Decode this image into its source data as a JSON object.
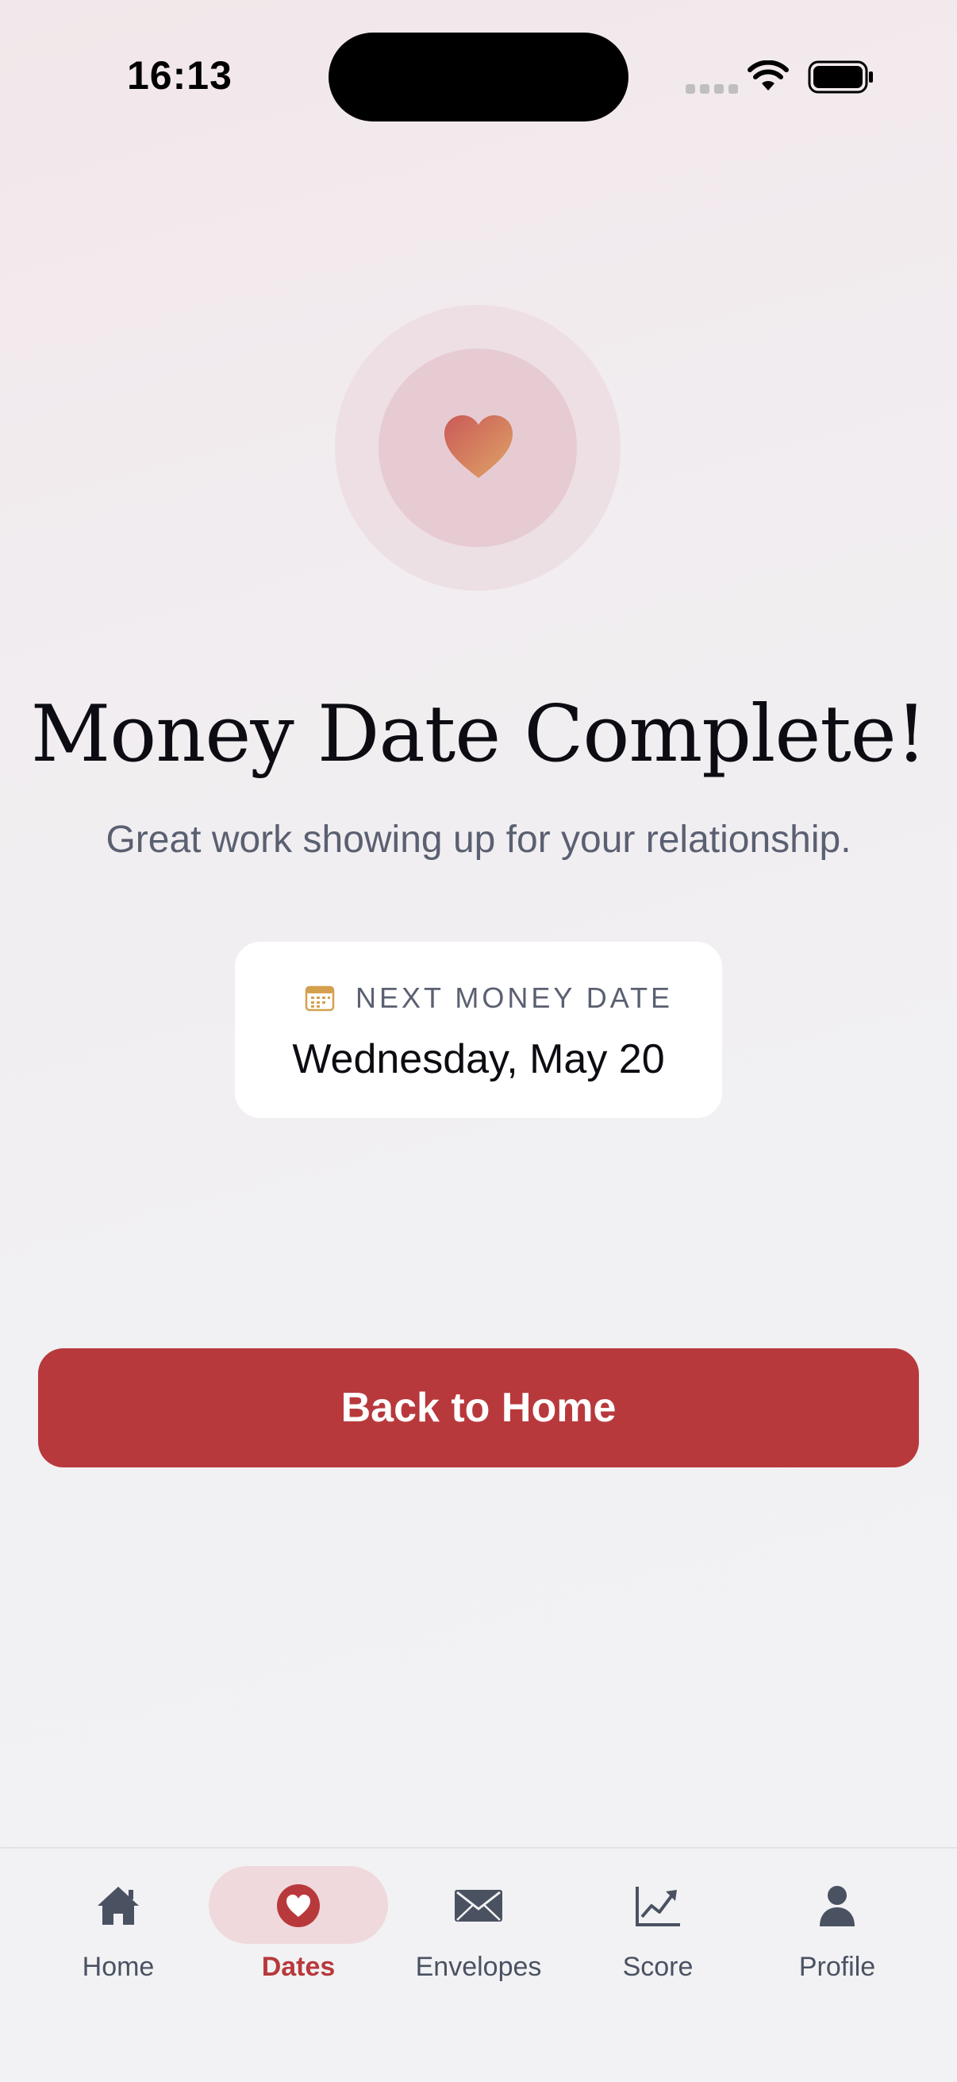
{
  "status_bar": {
    "time": "16:13"
  },
  "hero": {
    "icon": "heart-icon",
    "title": "Money Date Complete!",
    "subtitle": "Great work showing up for your relationship."
  },
  "next_date_card": {
    "icon": "calendar-icon",
    "label": "NEXT MONEY DATE",
    "date": "Wednesday, May 20"
  },
  "cta": {
    "label": "Back to Home"
  },
  "tabbar": {
    "items": [
      {
        "label": "Home",
        "icon": "home-icon",
        "active": false
      },
      {
        "label": "Dates",
        "icon": "heart-icon",
        "active": true
      },
      {
        "label": "Envelopes",
        "icon": "envelope-icon",
        "active": false
      },
      {
        "label": "Score",
        "icon": "chart-icon",
        "active": false
      },
      {
        "label": "Profile",
        "icon": "person-icon",
        "active": false
      }
    ]
  },
  "colors": {
    "accent": "#b8393c",
    "text_muted": "#5a6071",
    "tab_inactive": "#4a5262",
    "active_pill": "#efd9dc"
  }
}
